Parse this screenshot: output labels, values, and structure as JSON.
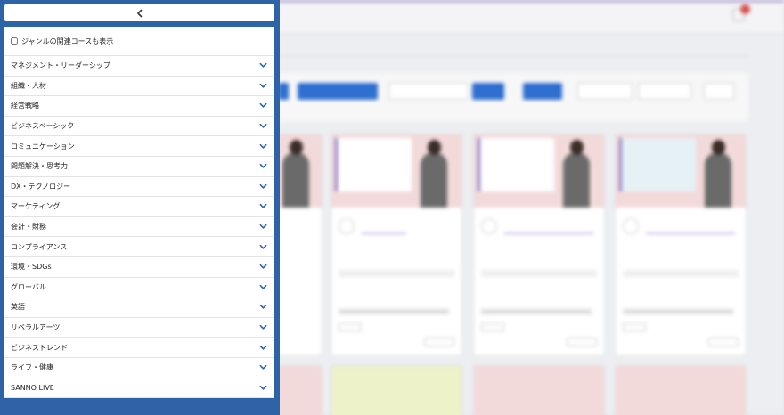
{
  "panel": {
    "back_icon": "chevron-left-icon",
    "related_checkbox": {
      "label": "ジャンルの関連コースも表示",
      "checked": false
    },
    "categories": [
      {
        "label": "マネジメント・リーダーシップ"
      },
      {
        "label": "組織・人材"
      },
      {
        "label": "経営戦略"
      },
      {
        "label": "ビジネスベーシック"
      },
      {
        "label": "コミュニケーション"
      },
      {
        "label": "問題解決・思考力"
      },
      {
        "label": "DX・テクノロジー"
      },
      {
        "label": "マーケティング"
      },
      {
        "label": "会計・財務"
      },
      {
        "label": "コンプライアンス"
      },
      {
        "label": "環境・SDGs"
      },
      {
        "label": "グローバル"
      },
      {
        "label": "英語"
      },
      {
        "label": "リベラルアーツ"
      },
      {
        "label": "ビジネストレンド"
      },
      {
        "label": "ライフ・健康"
      },
      {
        "label": "SANNO LIVE"
      }
    ]
  },
  "colors": {
    "panel_bg": "#2e63a8",
    "chevron": "#2e63a8"
  }
}
